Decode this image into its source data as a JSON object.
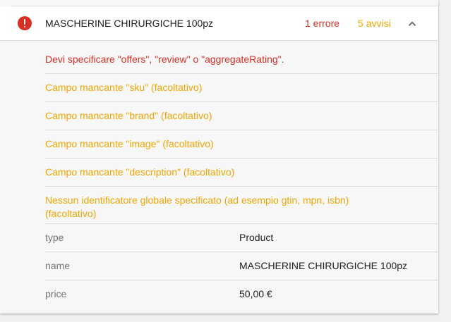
{
  "item": {
    "title": "MASCHERINE CHIRURGICHE 100pz",
    "error_count_label": "1 errore",
    "warning_count_label": "5 avvisi",
    "status_icon": "error-icon",
    "collapse_icon": "chevron-up-icon"
  },
  "issues": [
    {
      "severity": "error",
      "text": "Devi specificare \"offers\", \"review\" o \"aggregateRating\"."
    },
    {
      "severity": "warning",
      "text": "Campo mancante \"sku\" (facoltativo)"
    },
    {
      "severity": "warning",
      "text": "Campo mancante \"brand\" (facoltativo)"
    },
    {
      "severity": "warning",
      "text": "Campo mancante \"image\" (facoltativo)"
    },
    {
      "severity": "warning",
      "text": "Campo mancante \"description\" (facoltativo)"
    },
    {
      "severity": "warning",
      "text": "Nessun identificatore globale specificato (ad esempio gtin, mpn, isbn) (facoltativo)"
    }
  ],
  "properties": [
    {
      "key": "type",
      "value": "Product"
    },
    {
      "key": "name",
      "value": "MASCHERINE CHIRURGICHE 100pz"
    },
    {
      "key": "price",
      "value": "50,00 €"
    }
  ],
  "colors": {
    "error": "#d93025",
    "warning": "#f2a600",
    "text": "#202124",
    "muted": "#757575"
  }
}
